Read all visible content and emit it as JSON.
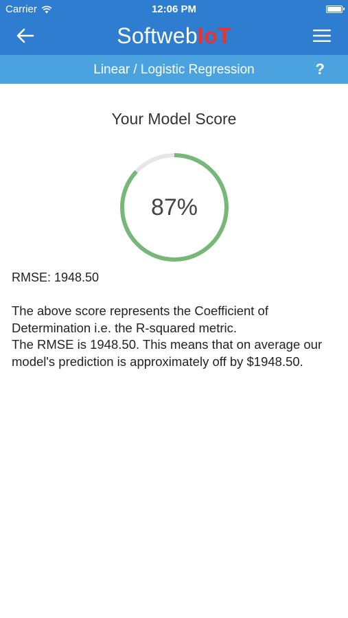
{
  "status_bar": {
    "carrier": "Carrier",
    "time": "12:06 PM",
    "icons": [
      "wifi-icon",
      "battery-icon"
    ]
  },
  "header": {
    "brand_part1": "Softweb",
    "brand_part2": "IoT",
    "back_icon": "arrow-left-icon",
    "menu_icon": "hamburger-menu-icon",
    "colors": {
      "header_bg": "#2e7dd1",
      "subbar_bg": "#4aa3df",
      "brand_accent": "#e8342c"
    }
  },
  "subbar": {
    "title": "Linear / Logistic Regression",
    "help_label": "?"
  },
  "content": {
    "score_title": "Your Model Score",
    "score_value": 87,
    "score_label": "87%",
    "gauge_colors": {
      "track": "#e6e6e6",
      "fill": "#77b777"
    },
    "rmse_label": "RMSE: 1948.50",
    "description_line1": "The above score represents the Coefficient of Determination i.e. the R-squared metric.",
    "description_line2": "The RMSE is 1948.50. This means that on average our model's prediction is approximately off by $1948.50."
  }
}
